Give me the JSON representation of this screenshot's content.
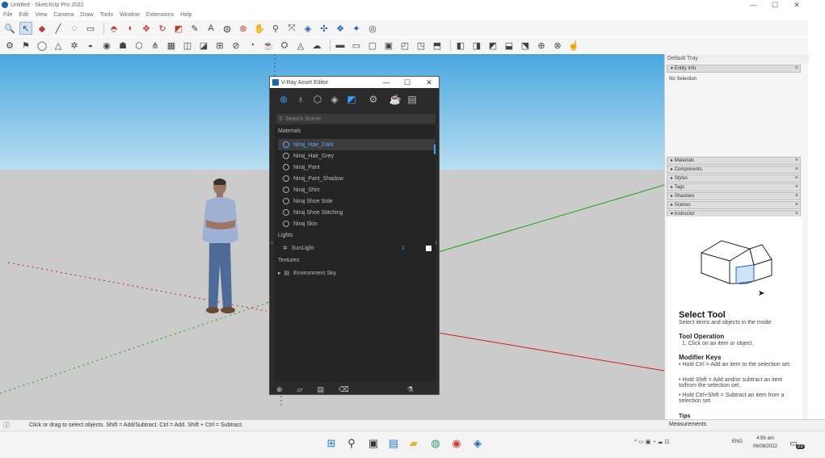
{
  "window": {
    "title": "Untitled - SketchUp Pro 2022",
    "minimize": "—",
    "maximize": "☐",
    "close": "✕"
  },
  "menu": [
    "File",
    "Edit",
    "View",
    "Camera",
    "Draw",
    "Tools",
    "Window",
    "Extensions",
    "Help"
  ],
  "vray": {
    "title": "V-Ray Asset Editor",
    "search_placeholder": "Search Scene",
    "sections": {
      "materials": "Materials",
      "lights": "Lights",
      "textures": "Textures"
    },
    "materials": [
      "Niraj_Hair_Dark",
      "Niraj_Hair_Grey",
      "Niraj_Pant",
      "Niraj_Pant_Shadow",
      "Niraj_Shirt",
      "Niraj Shoe Sole",
      "Niraj Shoe Stitching",
      "Niraj Skin"
    ],
    "selected_material_index": 0,
    "lights": [
      {
        "name": "SunLight",
        "value": "1"
      }
    ],
    "textures": [
      "Environment Sky"
    ]
  },
  "tray": {
    "header": "Default Tray",
    "entity_info": "Entity Info",
    "no_selection": "No Selection",
    "panels": [
      "Materials",
      "Components",
      "Styles",
      "Tags",
      "Shadows",
      "Scenes",
      "Instructor"
    ],
    "instructor": {
      "title": "Select Tool",
      "subtitle": "Select items and objects in the mode",
      "op_heading": "Tool Operation",
      "op_1": "1. Click on an item or object.",
      "mod_heading": "Modifier Keys",
      "mod_1": "• Hold Ctrl = Add an item to the selection set.",
      "mod_2": "• Hold Shift = Add and/or subtract an item to/from the selection set.",
      "mod_3": "• Hold Ctrl+Shift = Subtract an item from a selection set.",
      "tips": "Tips"
    }
  },
  "status": {
    "text": "Click or drag to select objects. Shift = Add/Subtract. Ctrl = Add. Shift + Ctrl = Subtract.",
    "measurements": "Measurements"
  },
  "taskbar": {
    "lang": "ENG",
    "time": "4:56 am",
    "date": "06/08/2022",
    "badge": "23"
  },
  "colors": {
    "sky_top": "#4aa7df",
    "ground": "#cbcbcb",
    "vray_bg": "#2b2b2b",
    "accent": "#3aa2ff"
  }
}
